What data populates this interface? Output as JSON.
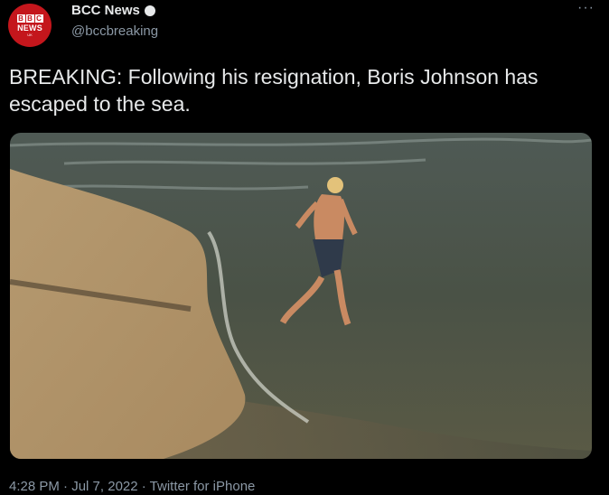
{
  "tweet": {
    "avatar": {
      "logo_letters": [
        "B",
        "B",
        "C"
      ],
      "logo_text": "NEWS",
      "logo_sub": "UK"
    },
    "display_name": "BCC News",
    "handle": "@bccbreaking",
    "more_label": "···",
    "text": "BREAKING: Following his resignation, Boris Johnson has escaped to the sea.",
    "meta": {
      "time": "4:28 PM",
      "separator": " · ",
      "date": "Jul 7, 2022",
      "source": "Twitter for iPhone"
    }
  },
  "icons": {
    "avatar": "bbc-news-logo",
    "verified": "verified-badge-icon",
    "more": "more-options-icon"
  },
  "colors": {
    "background": "#000000",
    "text_primary": "#e7e9ea",
    "text_secondary": "#8b98a5",
    "brand_red": "#c4161c"
  }
}
